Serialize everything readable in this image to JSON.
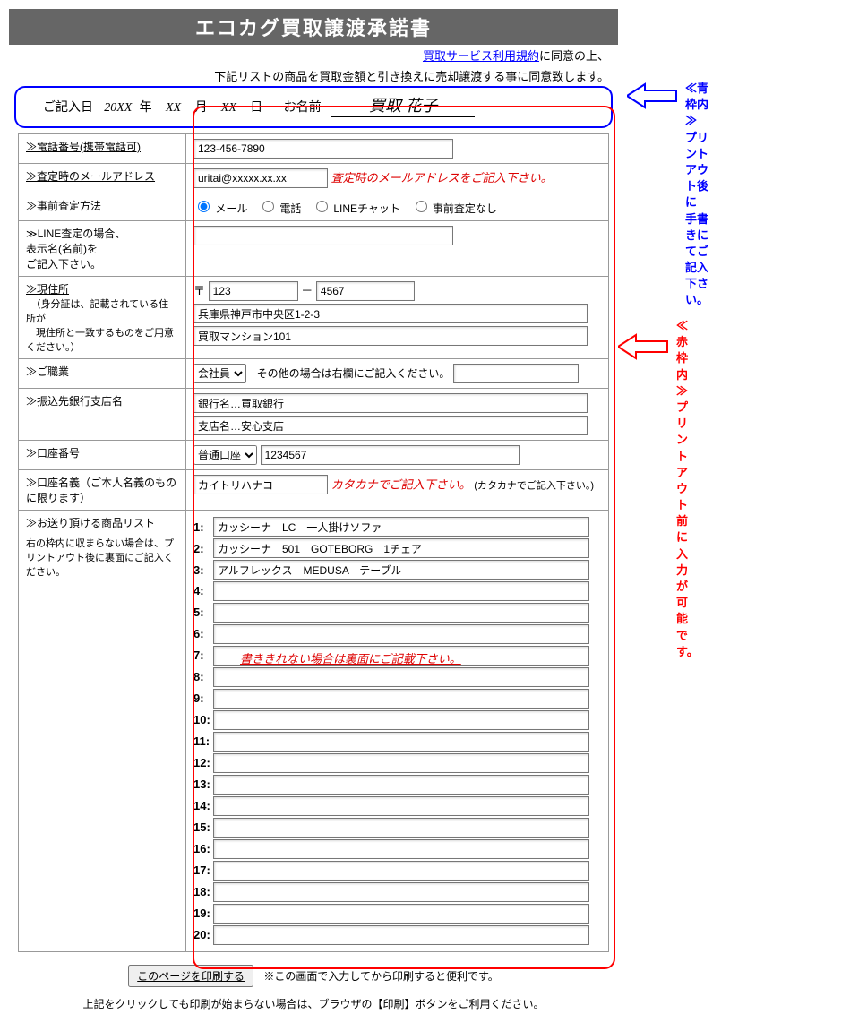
{
  "title": "エコカグ買取譲渡承諾書",
  "consent_link": "買取サービス利用規約",
  "consent_text_after": "に同意の上、",
  "consent_text2": "下記リストの商品を買取金額と引き換えに売却譲渡する事に同意致します。",
  "date_label": "ご記入日",
  "date_year": "20XX",
  "date_year_suffix": "年",
  "date_month": "XX",
  "date_month_suffix": "月",
  "date_day": "XX",
  "date_day_suffix": "日",
  "name_label": "お名前",
  "name_value": "買取 花子",
  "rows": {
    "phone_label": "≫電話番号(携帯電話可)",
    "phone_value": "123-456-7890",
    "email_label": "≫査定時のメールアドレス",
    "email_value": "uritai@xxxxx.xx.xx",
    "email_note": "査定時のメールアドレスをご記入下さい。",
    "method_label": "≫事前査定方法",
    "method_options": [
      "メール",
      "電話",
      "LINEチャット",
      "事前査定なし"
    ],
    "line_label": "≫LINE査定の場合、\n表示名(名前)を\nご記入下さい。",
    "addr_label": "≫現住所",
    "addr_sub": "　（身分証は、記載されている住所が\n　現住所と一致するものをご用意ください。）",
    "zip_mark": "〒",
    "zip1": "123",
    "zip_sep": "－",
    "zip2": "4567",
    "addr1": "兵庫県神戸市中央区1-2-3",
    "addr2": "買取マンション101",
    "job_label": "≫ご職業",
    "job_value": "会社員",
    "job_note": "その他の場合は右欄にご記入ください。",
    "bank_label": "≫振込先銀行支店名",
    "bank_name": "銀行名…買取銀行",
    "branch_name": "支店名…安心支店",
    "acct_label": "≫口座番号",
    "acct_type": "普通口座",
    "acct_no": "1234567",
    "holder_label": "≫口座名義（ご本人名義のものに限ります）",
    "holder_value": "カイトリハナコ",
    "holder_hint": "(カタカナでご記入下さい。)",
    "holder_note": "カタカナでご記入下さい。",
    "items_label": "≫お送り頂ける商品リスト",
    "items_sub": "右の枠内に収まらない場合は、プリントアウト後に裏面にご記入ください。",
    "items": [
      "カッシーナ　LC　一人掛けソファ",
      "カッシーナ　501　GOTEBORG　1チェア",
      "アルフレックス　MEDUSA　テーブル",
      "",
      "",
      "",
      "",
      "",
      "",
      "",
      "",
      "",
      "",
      "",
      "",
      "",
      "",
      "",
      "",
      ""
    ],
    "items_overflow_note": "書ききれない場合は裏面にご記載下さい。"
  },
  "annot_blue": "≪青枠内≫\nプリントアウト後に\n手書きにてご記入下さい。",
  "annot_red": "≪赤枠内≫\nプリントアウト前に\n入力が可能です。",
  "print_btn": "このページを印刷する",
  "print_note": "※この画面で入力してから印刷すると便利です。",
  "footer": "上記をクリックしても印刷が始まらない場合は、ブラウザの【印刷】ボタンをご利用ください。"
}
